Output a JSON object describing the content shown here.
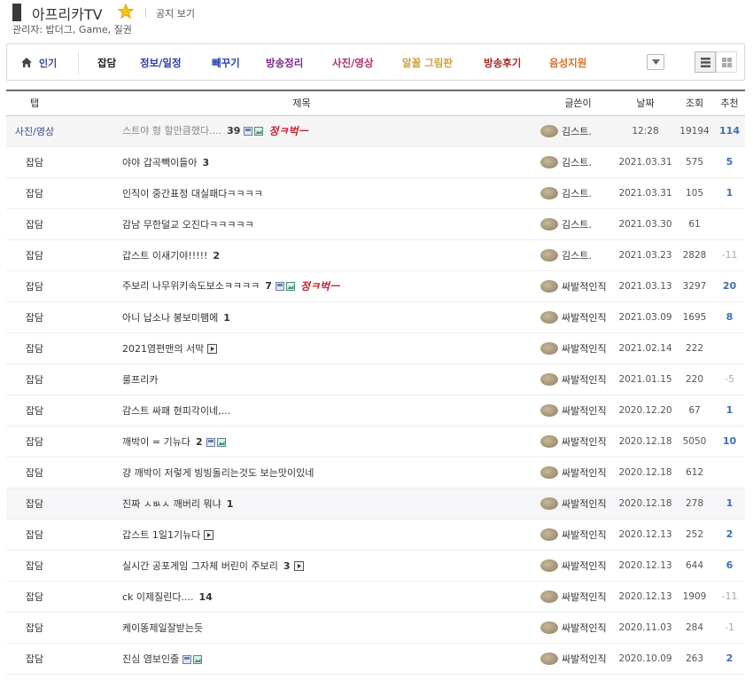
{
  "gallery": {
    "title": "아프리카TV",
    "notice_link": "공지 보기",
    "admins": "관리자: 밥더그, Game, 질권"
  },
  "tabs": [
    {
      "label": "인기",
      "color": "#3b4890"
    },
    {
      "label": "잡담",
      "color": "#222222"
    },
    {
      "label": "정보/일정",
      "color": "#2c3ea8"
    },
    {
      "label": "빼꾸기",
      "color": "#2c3ea8"
    },
    {
      "label": "방송정리",
      "color": "#7a2a8a"
    },
    {
      "label": "사진/영상",
      "color": "#b0306a"
    },
    {
      "label": "알꼴 그림판",
      "color": "#c9a23a"
    },
    {
      "label": "방송후기",
      "color": "#a32a2a"
    },
    {
      "label": "음성지원",
      "color": "#d0722a"
    }
  ],
  "table": {
    "headers": [
      "탭",
      "제목",
      "글쓴이",
      "날짜",
      "조회",
      "추천"
    ]
  },
  "posts": [
    {
      "tab": "사진/영상",
      "title": "스트야 형 할만큼했다....",
      "comments": "39",
      "icons": "img",
      "stamp": "정ㅋ벅ㅡ",
      "writer": "김스트.",
      "date": "12:28",
      "views": "19194",
      "rec": "114",
      "type": "notice"
    },
    {
      "tab": "잡담",
      "title": "야야 갑곡빽이들아",
      "comments": "3",
      "icons": "",
      "stamp": "",
      "writer": "김스트.",
      "date": "2021.03.31",
      "views": "575",
      "rec": "5"
    },
    {
      "tab": "잡담",
      "title": "인직이 중간표정 대실패다ㅋㅋㅋㅋ",
      "comments": "",
      "icons": "",
      "stamp": "",
      "writer": "김스트.",
      "date": "2021.03.31",
      "views": "105",
      "rec": "1"
    },
    {
      "tab": "잡담",
      "title": "감남 무한덜교 오진다ㅋㅋㅋㅋㅋ",
      "comments": "",
      "icons": "",
      "stamp": "",
      "writer": "김스트.",
      "date": "2021.03.30",
      "views": "61",
      "rec": ""
    },
    {
      "tab": "잡담",
      "title": "갑스트 이새기야!!!!!",
      "comments": "2",
      "icons": "",
      "stamp": "",
      "writer": "김스트.",
      "date": "2021.03.23",
      "views": "2828",
      "rec": "-11"
    },
    {
      "tab": "잡담",
      "title": "주보리 나무위키속도보소ㅋㅋㅋㅋ",
      "comments": "7",
      "icons": "img",
      "stamp": "정ㅋ벅ㅡ",
      "writer": "싸발적인직",
      "date": "2021.03.13",
      "views": "3297",
      "rec": "20"
    },
    {
      "tab": "잡담",
      "title": "아니 납소나 봉보미팸에",
      "comments": "1",
      "icons": "",
      "stamp": "",
      "writer": "싸발적인직",
      "date": "2021.03.09",
      "views": "1695",
      "rec": "8"
    },
    {
      "tab": "잡담",
      "title": "2021염편맨의 서막",
      "comments": "",
      "icons": "video",
      "stamp": "",
      "writer": "싸발적인직",
      "date": "2021.02.14",
      "views": "222",
      "rec": ""
    },
    {
      "tab": "잡담",
      "title": "룰프리카",
      "comments": "",
      "icons": "",
      "stamp": "",
      "writer": "싸발적인직",
      "date": "2021.01.15",
      "views": "220",
      "rec": "-5"
    },
    {
      "tab": "잡담",
      "title": "감스트 싸패 현피각이네,...",
      "comments": "",
      "icons": "",
      "stamp": "",
      "writer": "싸발적인직",
      "date": "2020.12.20",
      "views": "67",
      "rec": "1"
    },
    {
      "tab": "잡담",
      "title": "깨박이 = 기뉴다",
      "comments": "2",
      "icons": "img",
      "stamp": "",
      "writer": "싸발적인직",
      "date": "2020.12.18",
      "views": "5050",
      "rec": "10"
    },
    {
      "tab": "잡담",
      "title": "걍 깨박이 저렇게 빙빙돌리는것도 보는맛이있네",
      "comments": "",
      "icons": "",
      "stamp": "",
      "writer": "싸발적인직",
      "date": "2020.12.18",
      "views": "612",
      "rec": ""
    },
    {
      "tab": "잡담",
      "title": "진짜 ㅅㅄㅅ 깨버리 뭐냐",
      "comments": "1",
      "icons": "",
      "stamp": "",
      "writer": "싸발적인직",
      "date": "2020.12.18",
      "views": "278",
      "rec": "1",
      "type": "hl"
    },
    {
      "tab": "잡담",
      "title": "갑스트 1일1기뉴다",
      "comments": "",
      "icons": "video",
      "stamp": "",
      "writer": "싸발적인직",
      "date": "2020.12.13",
      "views": "252",
      "rec": "2"
    },
    {
      "tab": "잡담",
      "title": "실시간 공포게임 그자체 버린이 주보리",
      "comments": "3",
      "icons": "video",
      "stamp": "",
      "writer": "싸발적인직",
      "date": "2020.12.13",
      "views": "644",
      "rec": "6"
    },
    {
      "tab": "잡담",
      "title": "ck 이제질린다....",
      "comments": "14",
      "icons": "",
      "stamp": "",
      "writer": "싸발적인직",
      "date": "2020.12.13",
      "views": "1909",
      "rec": "-11"
    },
    {
      "tab": "잡담",
      "title": "케이똥제일잘받는듯",
      "comments": "",
      "icons": "",
      "stamp": "",
      "writer": "싸발적인직",
      "date": "2020.11.03",
      "views": "284",
      "rec": "-1"
    },
    {
      "tab": "잡담",
      "title": "진심 염보인줄",
      "comments": "",
      "icons": "img",
      "stamp": "",
      "writer": "싸발적인직",
      "date": "2020.10.09",
      "views": "263",
      "rec": "2"
    }
  ]
}
